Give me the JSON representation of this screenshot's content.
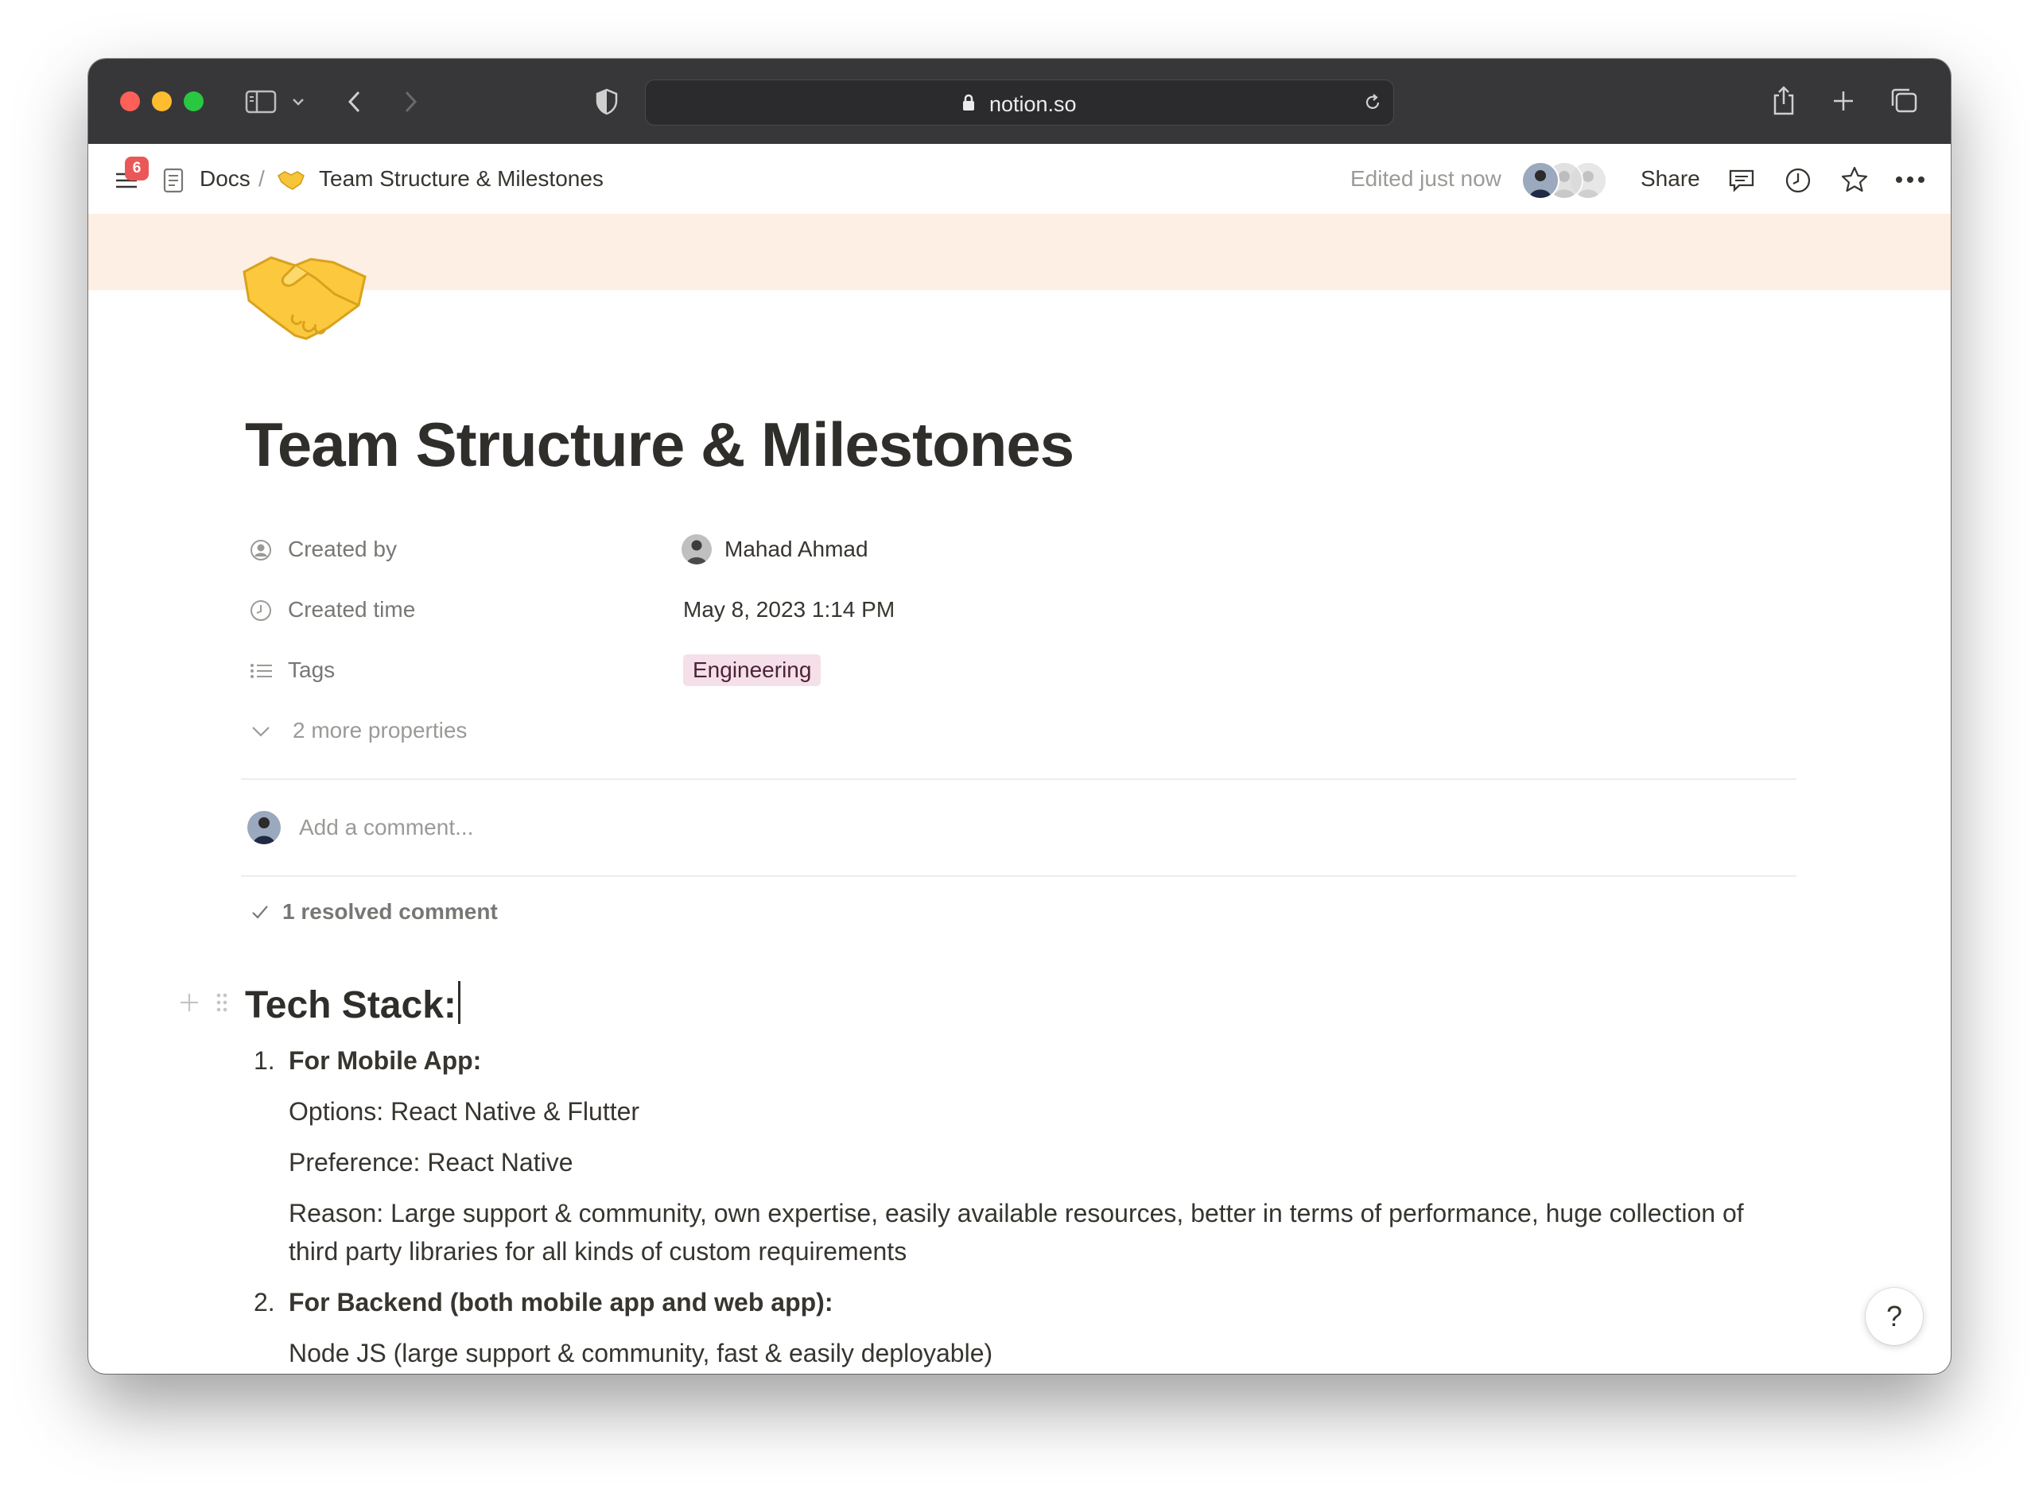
{
  "browser": {
    "url": "notion.so"
  },
  "topbar": {
    "notification_count": "6",
    "breadcrumb_root": "Docs",
    "breadcrumb_sep": "/",
    "breadcrumb_page": "Team Structure & Milestones",
    "edited_status": "Edited just now",
    "share_label": "Share"
  },
  "page": {
    "icon": "handshake-emoji",
    "cover_color": "#fdefe3",
    "title": "Team Structure & Milestones",
    "properties": [
      {
        "label": "Created by",
        "value": "Mahad Ahmad",
        "icon": "person-circle-icon"
      },
      {
        "label": "Created time",
        "value": "May 8, 2023 1:14 PM",
        "icon": "clock-icon"
      },
      {
        "label": "Tags",
        "value": "Engineering",
        "icon": "list-icon"
      }
    ],
    "more_properties": "2 more properties",
    "comment_placeholder": "Add a comment...",
    "resolved_comments": "1 resolved comment",
    "heading": "Tech Stack:",
    "list": [
      {
        "number": "1.",
        "title": "For Mobile App:",
        "lines": [
          "Options: React Native & Flutter",
          "Preference: React Native",
          "Reason: Large support & community, own expertise, easily available resources, better in terms of performance, huge collection of",
          "third party libraries for all kinds of custom requirements"
        ]
      },
      {
        "number": "2.",
        "title": "For Backend (both mobile app and web app):",
        "lines": [
          "Node JS (large support & community, fast & easily deployable)"
        ]
      }
    ]
  },
  "help_label": "?",
  "colors": {
    "titlebar": "#37373a",
    "tag_bg": "#f5e0e9",
    "badge": "#eb5757"
  }
}
